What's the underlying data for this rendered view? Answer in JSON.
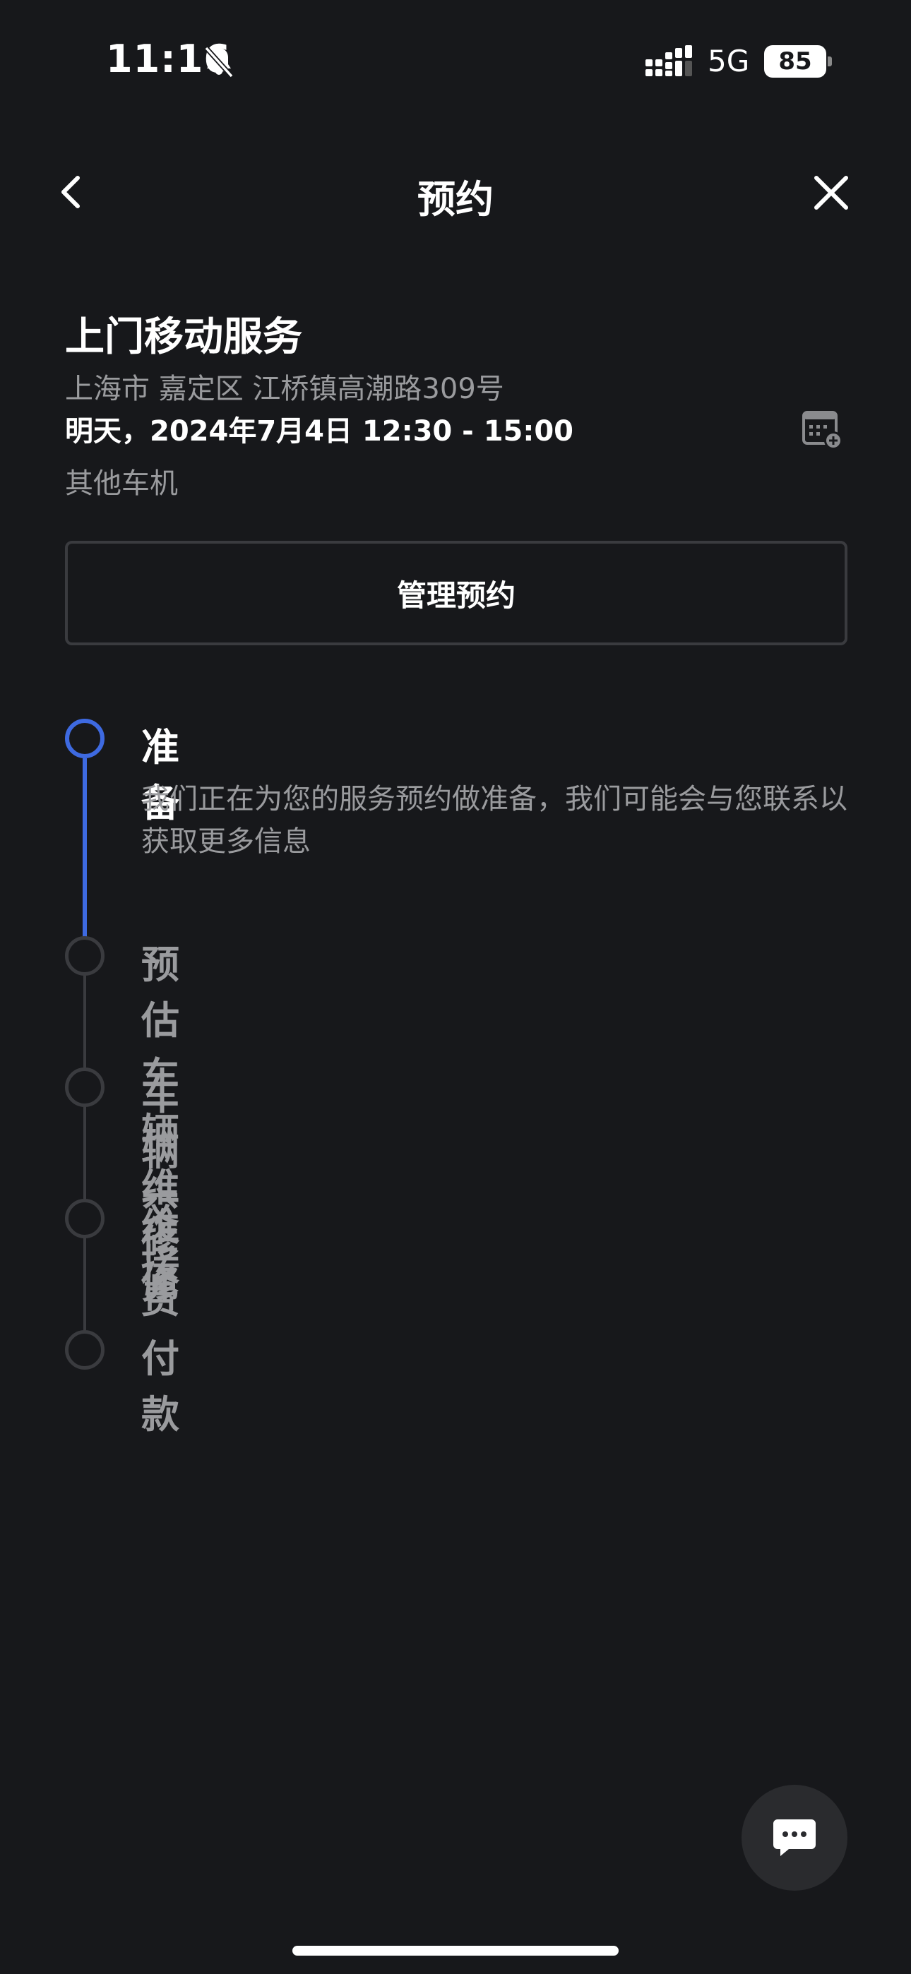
{
  "status_bar": {
    "time": "11:16",
    "network": "5G",
    "battery": "85"
  },
  "nav": {
    "title": "预约"
  },
  "service": {
    "title": "上门移动服务",
    "address": "上海市 嘉定区 江桥镇高潮路309号",
    "time": "明天，2024年7月4日 12:30 - 15:00",
    "type": "其他车机"
  },
  "manage_button": {
    "label": "管理预约"
  },
  "steps": [
    {
      "title": "准备",
      "description": "我们正在为您的服务预约做准备，我们可能会与您联系以获取更多信息",
      "active": true
    },
    {
      "title": "预估车辆维修费",
      "active": false
    },
    {
      "title": "车辆交接",
      "active": false
    },
    {
      "title": "维修",
      "active": false
    },
    {
      "title": "付款",
      "active": false
    }
  ],
  "colors": {
    "background": "#17181b",
    "accent": "#3e6ae1",
    "muted": "#9a9b9e",
    "border": "#3a3b3f"
  },
  "icons": [
    "bell-muted-icon",
    "signal-icon",
    "back-icon",
    "close-icon",
    "calendar-add-icon",
    "chat-icon"
  ]
}
